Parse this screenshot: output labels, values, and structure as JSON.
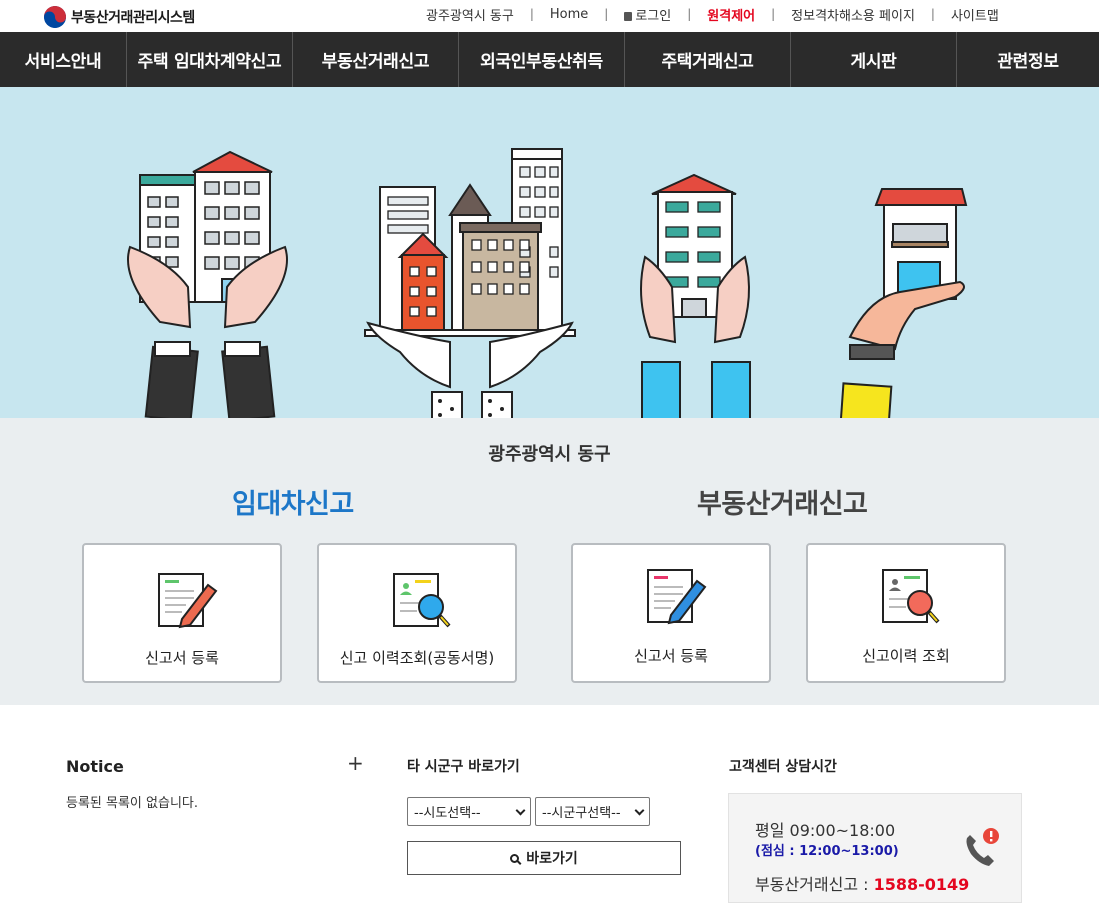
{
  "header": {
    "site_name": "부동산거래관리시스템",
    "utils": {
      "region": "광주광역시 동구",
      "home": "Home",
      "login": "로그인",
      "remote": "원격제어",
      "accessibility": "정보격차해소용 페이지",
      "sitemap": "사이트맵"
    }
  },
  "gnb": [
    "서비스안내",
    "주택 임대차계약신고",
    "부동산거래신고",
    "외국인부동산취득",
    "주택거래신고",
    "게시판",
    "관련정보"
  ],
  "service": {
    "region": "광주광역시 동구",
    "lease": {
      "title": "임대차신고",
      "register": "신고서 등록",
      "history": "신고 이력조회(공동서명)"
    },
    "trade": {
      "title": "부동산거래신고",
      "register": "신고서 등록",
      "history": "신고이력 조회"
    }
  },
  "notice": {
    "title": "Notice",
    "more": "+",
    "empty": "등록된 목록이 없습니다."
  },
  "goto": {
    "title": "타 시군구 바로가기",
    "sido": "--시도선택--",
    "sigungu": "--시군구선택--",
    "button": "바로가기"
  },
  "cs": {
    "title": "고객센터 상담시간",
    "hours": "평일 09:00~18:00",
    "lunch": "(점심 : 12:00~13:00)",
    "phone_label": "부동산거래신고 : ",
    "phone_number": "1588-0149"
  },
  "colors": {
    "gnb_bg": "#2b2b2b",
    "hero_bg": "#c7e6ef",
    "accent_blue": "#1d77c8",
    "accent_red": "#e4061f"
  }
}
